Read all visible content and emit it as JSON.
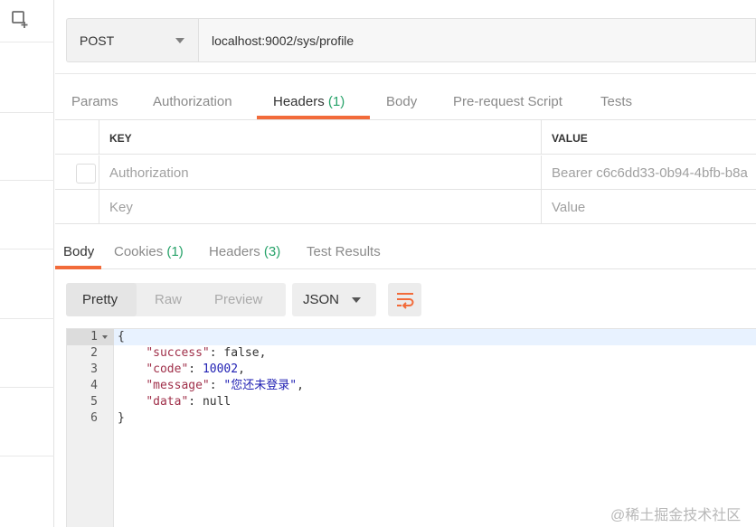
{
  "request": {
    "method": "POST",
    "url": "localhost:9002/sys/profile"
  },
  "request_tabs": [
    {
      "label": "Params"
    },
    {
      "label": "Authorization"
    },
    {
      "label": "Headers",
      "count": "(1)"
    },
    {
      "label": "Body"
    },
    {
      "label": "Pre-request Script"
    },
    {
      "label": "Tests"
    }
  ],
  "headers_table": {
    "key_header": "KEY",
    "value_header": "VALUE",
    "rows": [
      {
        "key": "Authorization",
        "value": "Bearer c6c6dd33-0b94-4bfb-b8a"
      }
    ],
    "placeholder_key": "Key",
    "placeholder_value": "Value"
  },
  "response_tabs": [
    {
      "label": "Body"
    },
    {
      "label": "Cookies",
      "count": "(1)"
    },
    {
      "label": "Headers",
      "count": "(3)"
    },
    {
      "label": "Test Results"
    }
  ],
  "response_toolbar": {
    "views": [
      "Pretty",
      "Raw",
      "Preview"
    ],
    "format": "JSON"
  },
  "response_body": {
    "line_numbers": [
      "1",
      "2",
      "3",
      "4",
      "5",
      "6"
    ],
    "open_brace": "{",
    "close_brace": "}",
    "success_key": "\"success\"",
    "success_val": "false",
    "code_key": "\"code\"",
    "code_val": "10002",
    "message_key": "\"message\"",
    "message_val": "\"您还未登录\"",
    "data_key": "\"data\"",
    "data_val": "null"
  },
  "watermark": "@稀土掘金技术社区",
  "colors": {
    "accent": "#f26b3a",
    "count_green": "#26a269"
  },
  "icons": {
    "new_tab": "new-tab-icon",
    "wrap": "wrap-lines-icon"
  }
}
